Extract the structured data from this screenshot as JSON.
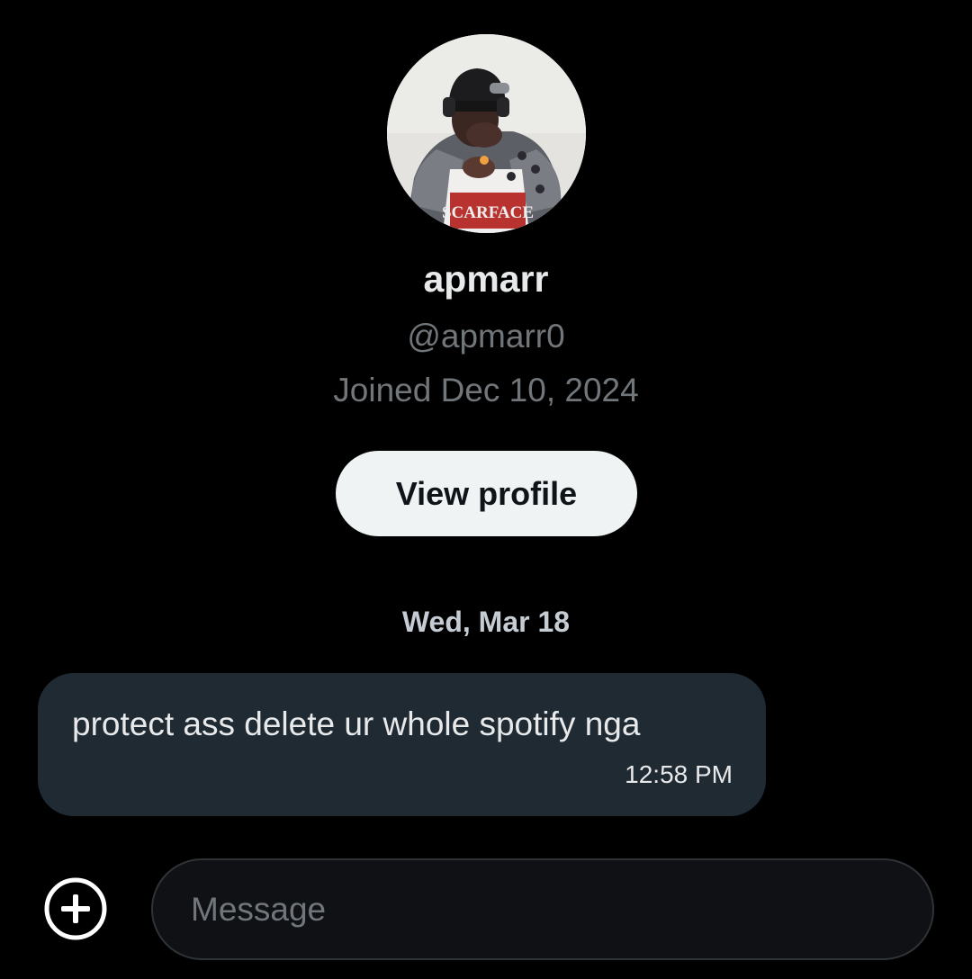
{
  "profile": {
    "display_name": "apmarr",
    "handle": "@apmarr0",
    "joined": "Joined Dec 10, 2024",
    "view_profile_label": "View profile",
    "shirt_text": "SCARFACE"
  },
  "conversation": {
    "date_separator": "Wed, Mar 18",
    "messages": [
      {
        "text": "protect ass delete ur whole spotify nga",
        "time": "12:58 PM"
      }
    ]
  },
  "composer": {
    "placeholder": "Message",
    "value": "",
    "add_icon": "plus-circle-icon"
  },
  "colors": {
    "background": "#000000",
    "bubble": "#202a33",
    "secondary_text": "#71767b",
    "button_bg": "#eff3f4"
  }
}
